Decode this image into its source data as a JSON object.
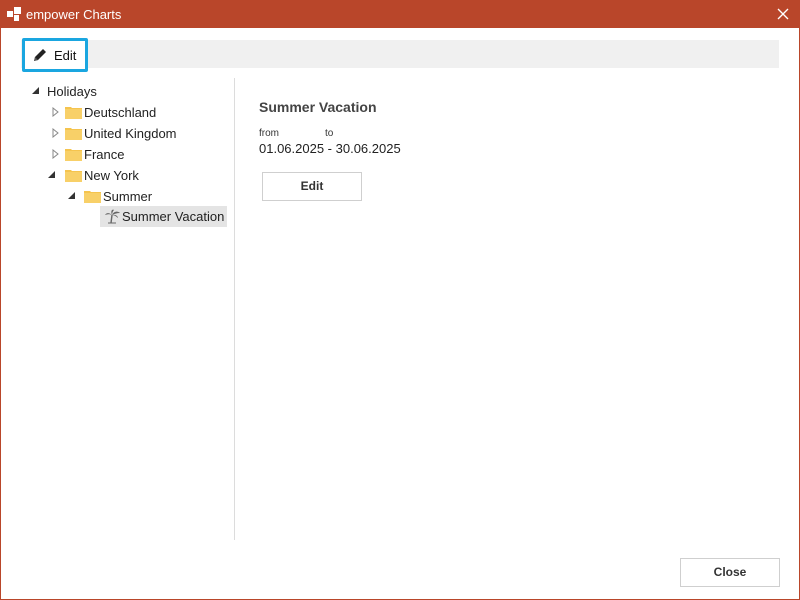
{
  "window": {
    "title": "empower Charts",
    "accent_color": "#b9462a"
  },
  "toolbar": {
    "edit_label": "Edit",
    "edit_icon": "pencil-icon",
    "highlight_color": "#1aa6e0"
  },
  "tree": {
    "root": "Holidays",
    "items": [
      {
        "label": "Deutschland",
        "expanded": false
      },
      {
        "label": "United Kingdom",
        "expanded": false
      },
      {
        "label": "France",
        "expanded": false
      },
      {
        "label": "New York",
        "expanded": true
      },
      {
        "label": "Summer",
        "expanded": true
      },
      {
        "label": "Summer Vacation",
        "selected": true,
        "icon": "palm-tree-icon"
      }
    ]
  },
  "detail": {
    "title": "Summer Vacation",
    "from_label": "from",
    "to_label": "to",
    "range": "01.06.2025 - 30.06.2025",
    "edit_label": "Edit"
  },
  "footer": {
    "close_label": "Close"
  }
}
